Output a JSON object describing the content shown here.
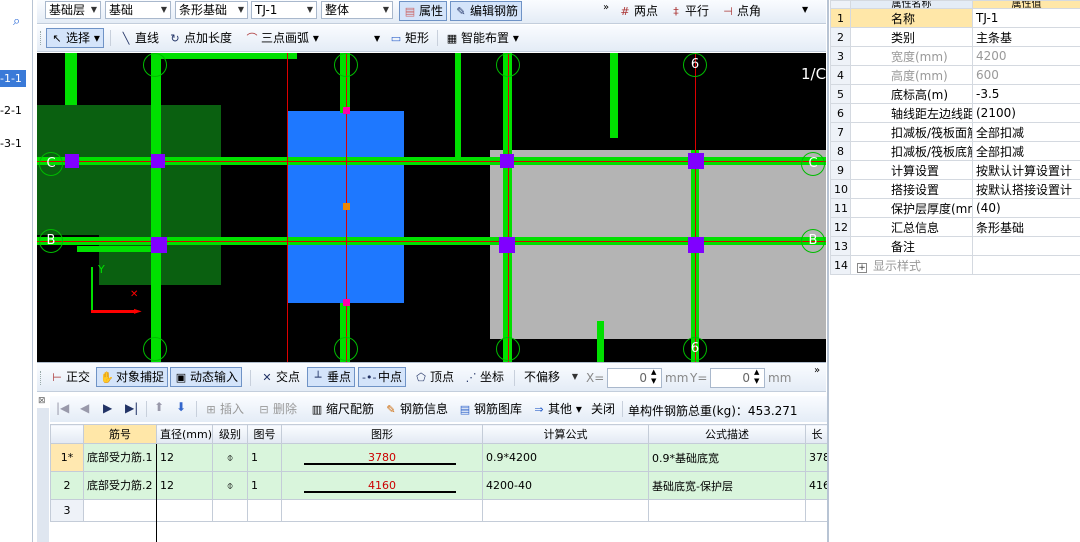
{
  "toolbar1": {
    "dd_layer": "基础层",
    "dd_type": "基础",
    "dd_sub": "条形基础",
    "dd_elem": "TJ-1",
    "dd_scope": "整体",
    "btn_prop": "属性",
    "btn_edit": "编辑钢筋",
    "btn_twopt": "两点",
    "btn_parallel": "平行",
    "btn_ptangle": "点角"
  },
  "toolbar2": {
    "select": "选择",
    "line": "直线",
    "ptlen": "点加长度",
    "arc3": "三点画弧",
    "rect": "矩形",
    "smart": "智能布置"
  },
  "left_tree": {
    "items": [
      "-1-1",
      "-2-1",
      "-3-1"
    ]
  },
  "canvas": {
    "axis_labels": [
      "6",
      "6",
      "C",
      "C",
      "B",
      "B",
      "1/C"
    ],
    "axis_y": "Y"
  },
  "snapbar": {
    "ortho": "正交",
    "snap": "对象捕捉",
    "dyn": "动态输入",
    "cross": "交点",
    "perp": "垂点",
    "mid": "中点",
    "vertex": "顶点",
    "coord": "坐标",
    "nooffset": "不偏移",
    "x_label": "X=",
    "x_val": "0",
    "mm1": "mm",
    "y_label": "Y=",
    "y_val": "0",
    "mm2": "mm"
  },
  "rebar_toolbar": {
    "insert": "插入",
    "delete": "删除",
    "scale": "缩尺配筋",
    "info": "钢筋信息",
    "lib": "钢筋图库",
    "other": "其他",
    "close": "关闭",
    "total": "单构件钢筋总重(kg)：453.271"
  },
  "rebar_table": {
    "headers": [
      "筋号",
      "直径(mm)",
      "级别",
      "图号",
      "图形",
      "计算公式",
      "公式描述",
      "长"
    ],
    "rows": [
      {
        "idx": "1*",
        "name": "底部受力筋.1",
        "dia": "12",
        "grade": "⌽",
        "fig": "1",
        "shape": "3780",
        "formula": "0.9*4200",
        "desc": "0.9*基础底宽",
        "len": "378"
      },
      {
        "idx": "2",
        "name": "底部受力筋.2",
        "dia": "12",
        "grade": "⌽",
        "fig": "1",
        "shape": "4160",
        "formula": "4200-40",
        "desc": "基础底宽-保护层",
        "len": "416"
      },
      {
        "idx": "3",
        "name": "",
        "dia": "",
        "grade": "",
        "fig": "",
        "shape": "",
        "formula": "",
        "desc": "",
        "len": ""
      }
    ]
  },
  "props": {
    "header": [
      "属性名称",
      "属性值"
    ],
    "rows": [
      {
        "n": "1",
        "name": "名称",
        "val": "TJ-1"
      },
      {
        "n": "2",
        "name": "类别",
        "val": "主条基"
      },
      {
        "n": "3",
        "name": "宽度(mm)",
        "val": "4200"
      },
      {
        "n": "4",
        "name": "高度(mm)",
        "val": "600"
      },
      {
        "n": "5",
        "name": "底标高(m)",
        "val": "-3.5"
      },
      {
        "n": "6",
        "name": "轴线距左边线距离",
        "val": "(2100)"
      },
      {
        "n": "7",
        "name": "扣减板/筏板面筋",
        "val": "全部扣减"
      },
      {
        "n": "8",
        "name": "扣减板/筏板底筋",
        "val": "全部扣减"
      },
      {
        "n": "9",
        "name": "计算设置",
        "val": "按默认计算设置计"
      },
      {
        "n": "10",
        "name": "搭接设置",
        "val": "按默认搭接设置计"
      },
      {
        "n": "11",
        "name": "保护层厚度(mm)",
        "val": "(40)"
      },
      {
        "n": "12",
        "name": "汇总信息",
        "val": "条形基础"
      },
      {
        "n": "13",
        "name": "备注",
        "val": ""
      },
      {
        "n": "14",
        "name": "显示样式",
        "val": ""
      }
    ]
  }
}
